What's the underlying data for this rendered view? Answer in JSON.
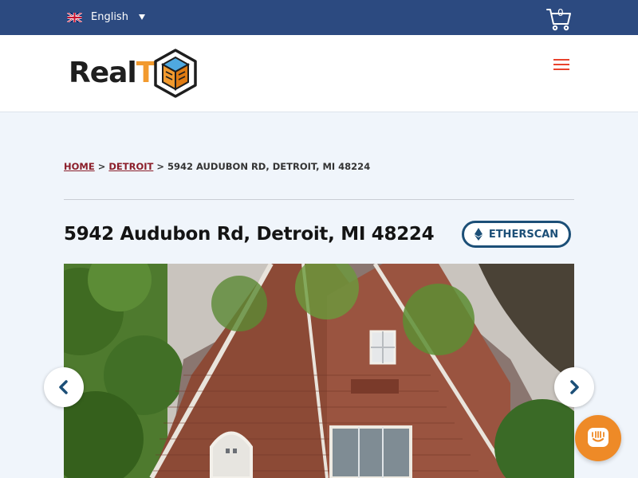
{
  "topbar": {
    "language_label": "English",
    "flag_icon": "uk-flag-icon",
    "cart_icon": "shopping-cart-icon",
    "cart_count": "0"
  },
  "header": {
    "logo_text_main": "Real",
    "logo_text_accent": "T",
    "menu_icon": "hamburger-menu-icon"
  },
  "breadcrumb": {
    "home": "HOME",
    "separator": ">",
    "city": "DETROIT",
    "current": "5942 AUDUBON RD, DETROIT, MI 48224"
  },
  "property": {
    "title": "5942 Audubon Rd, Detroit, MI 48224",
    "etherscan_label": "ETHERSCAN"
  },
  "gallery": {
    "prev_icon": "chevron-left-icon",
    "next_icon": "chevron-right-icon"
  },
  "chat": {
    "icon": "chat-icon"
  },
  "colors": {
    "topbar": "#2c4a80",
    "accent_orange": "#f29a2e",
    "breadcrumb_link": "#8b1e2a",
    "etherscan_blue": "#1c4f77",
    "menu_red": "#e8432d",
    "page_bg": "#f0f5fb"
  }
}
